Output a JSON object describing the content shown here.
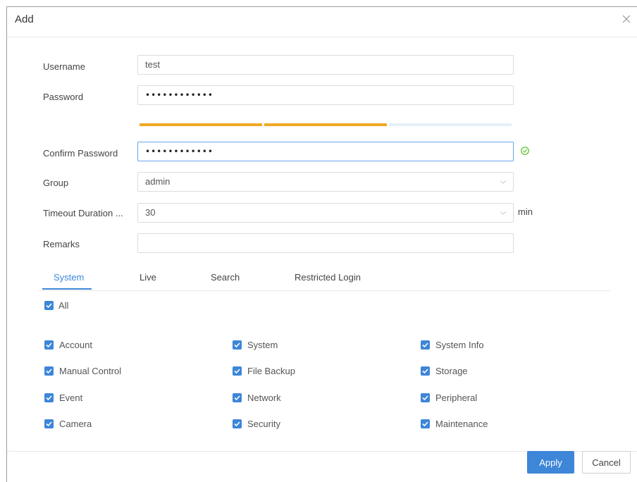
{
  "dialog": {
    "title": "Add"
  },
  "form": {
    "username": {
      "label": "Username",
      "value": "test"
    },
    "password": {
      "label": "Password",
      "value": "••••••••••••"
    },
    "strength": {
      "filled_segments": 2,
      "total_segments": 3,
      "color": "#f2a825"
    },
    "confirm_password": {
      "label": "Confirm Password",
      "value": "••••••••••••",
      "valid_icon": "check-circle-icon"
    },
    "group": {
      "label": "Group",
      "value": "admin"
    },
    "timeout": {
      "label": "Timeout Duration ...",
      "value": "30",
      "unit": "min"
    },
    "remarks": {
      "label": "Remarks",
      "value": ""
    }
  },
  "tabs": [
    {
      "label": "System",
      "active": true
    },
    {
      "label": "Live",
      "active": false
    },
    {
      "label": "Search",
      "active": false
    },
    {
      "label": "Restricted Login",
      "active": false
    }
  ],
  "permissions": {
    "all": {
      "label": "All",
      "checked": true
    },
    "items": [
      {
        "label": "Account",
        "checked": true
      },
      {
        "label": "System",
        "checked": true
      },
      {
        "label": "System Info",
        "checked": true
      },
      {
        "label": "Manual Control",
        "checked": true
      },
      {
        "label": "File Backup",
        "checked": true
      },
      {
        "label": "Storage",
        "checked": true
      },
      {
        "label": "Event",
        "checked": true
      },
      {
        "label": "Network",
        "checked": true
      },
      {
        "label": "Peripheral",
        "checked": true
      },
      {
        "label": "Camera",
        "checked": true
      },
      {
        "label": "Security",
        "checked": true
      },
      {
        "label": "Maintenance",
        "checked": true
      }
    ]
  },
  "buttons": {
    "apply": "Apply",
    "cancel": "Cancel"
  },
  "colors": {
    "accent": "#3d86d8",
    "success": "#52c41a",
    "strength": "#f2a825"
  }
}
